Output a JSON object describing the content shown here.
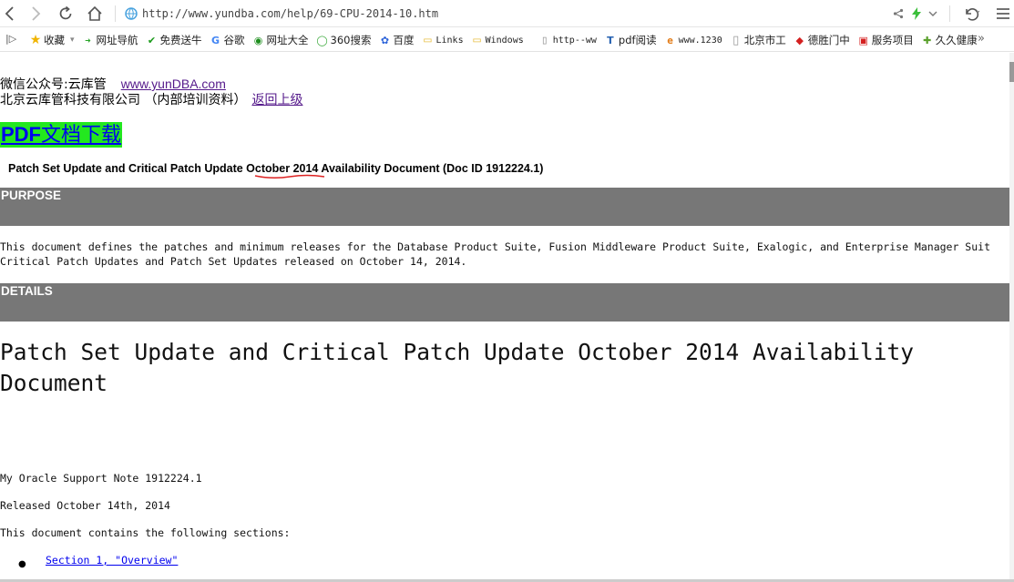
{
  "browser": {
    "url": "http://www.yundba.com/help/69-CPU-2014-10.htm",
    "icons": [
      "back-icon",
      "forward-icon",
      "reload-icon",
      "home-icon",
      "share-icon",
      "lightning-icon",
      "chevron-down-icon",
      "undo-icon",
      "menu-icon"
    ]
  },
  "bookmarks": [
    {
      "label": "收藏",
      "icon": "star-icon"
    },
    {
      "label": "网址导航",
      "icon": "nav-icon"
    },
    {
      "label": "免费送牛",
      "icon": "shield-icon"
    },
    {
      "label": "谷歌",
      "icon": "google-icon"
    },
    {
      "label": "网址大全",
      "icon": "globe-icon"
    },
    {
      "label": "360搜索",
      "icon": "360-icon"
    },
    {
      "label": "百度",
      "icon": "baidu-icon"
    },
    {
      "label": "Links",
      "icon": "folder-icon"
    },
    {
      "label": "Windows",
      "icon": "folder-icon"
    },
    {
      "label": "http--ww",
      "icon": "page-icon"
    },
    {
      "label": "pdf阅读",
      "icon": "pdf-icon"
    },
    {
      "label": "www.1230",
      "icon": "ie-icon"
    },
    {
      "label": "北京市工",
      "icon": "page-icon"
    },
    {
      "label": "德胜门中",
      "icon": "diamond-icon"
    },
    {
      "label": "服务项目",
      "icon": "service-icon"
    },
    {
      "label": "久久健康",
      "icon": "health-icon"
    }
  ],
  "header": {
    "wechat": "微信公众号:云库管",
    "site_link": "www.yunDBA.com",
    "company": "北京云库管科技有限公司 （内部培训资料）",
    "back_link": "返回上级"
  },
  "pdf_link": {
    "bold": "PDF",
    "rest": "文档下载"
  },
  "doc_title": {
    "before": "Patch Set Update and Critical Patch Update ",
    "highlight": "October 2014",
    "after": " Availability Document (Doc ID 1912224.1)"
  },
  "sections": {
    "purpose": "PURPOSE",
    "details": "DETAILS"
  },
  "purpose_text": [
    "This document defines the patches and minimum releases for the Database Product Suite, Fusion Middleware Product Suite, Exalogic, and Enterprise Manager Suit",
    "Critical Patch Updates and Patch Set Updates released on October 14, 2014."
  ],
  "main_title": "Patch Set Update and Critical Patch Update October 2014 Availability Document",
  "note": "My Oracle Support Note 1912224.1",
  "released": "Released October 14th, 2014",
  "contains": "This document contains the following sections:",
  "toc": [
    "Section 1, \"Overview\""
  ]
}
